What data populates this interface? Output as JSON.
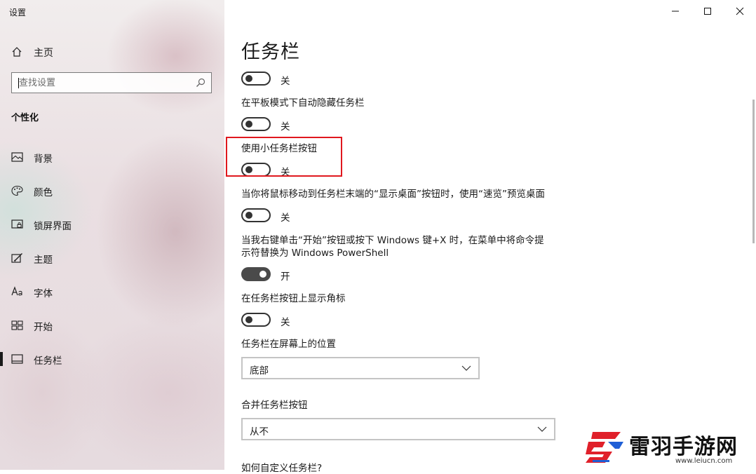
{
  "window": {
    "title": "设置"
  },
  "sidebar": {
    "home_label": "主页",
    "search_placeholder": "查找设置",
    "section_title": "个性化",
    "items": [
      {
        "label": "背景",
        "icon": "picture-icon"
      },
      {
        "label": "颜色",
        "icon": "palette-icon"
      },
      {
        "label": "锁屏界面",
        "icon": "lock-screen-icon"
      },
      {
        "label": "主题",
        "icon": "theme-brush-icon"
      },
      {
        "label": "字体",
        "icon": "font-icon"
      },
      {
        "label": "开始",
        "icon": "start-menu-icon"
      },
      {
        "label": "任务栏",
        "icon": "taskbar-icon",
        "active": true
      }
    ]
  },
  "main": {
    "page_title": "任务栏",
    "settings": [
      {
        "label": "",
        "state": "关",
        "on": false
      },
      {
        "label": "在平板模式下自动隐藏任务栏",
        "state": "关",
        "on": false
      },
      {
        "label": "使用小任务栏按钮",
        "state": "关",
        "on": false
      },
      {
        "label": "当你将鼠标移动到任务栏末端的“显示桌面”按钮时，使用“速览”预览桌面",
        "state": "关",
        "on": false
      },
      {
        "label_line1": "当我右键单击“开始”按钮或按下 Windows 键+X 时，在菜单中将命令提",
        "label_line2": "示符替换为 Windows PowerShell",
        "state": "开",
        "on": true
      },
      {
        "label": "在任务栏按钮上显示角标",
        "state": "关",
        "on": false
      }
    ],
    "position": {
      "label": "任务栏在屏幕上的位置",
      "value": "底部"
    },
    "combine": {
      "label": "合并任务栏按钮",
      "value": "从不"
    },
    "help_link": "如何自定义任务栏?"
  },
  "watermark": {
    "text": "雷羽手游网",
    "url": "www.leiucn.com",
    "accent": "#e0202a",
    "accent2": "#1f5fd6"
  },
  "colors": {
    "highlight": "#e0181e",
    "toggle_on": "#4a4a4a"
  }
}
